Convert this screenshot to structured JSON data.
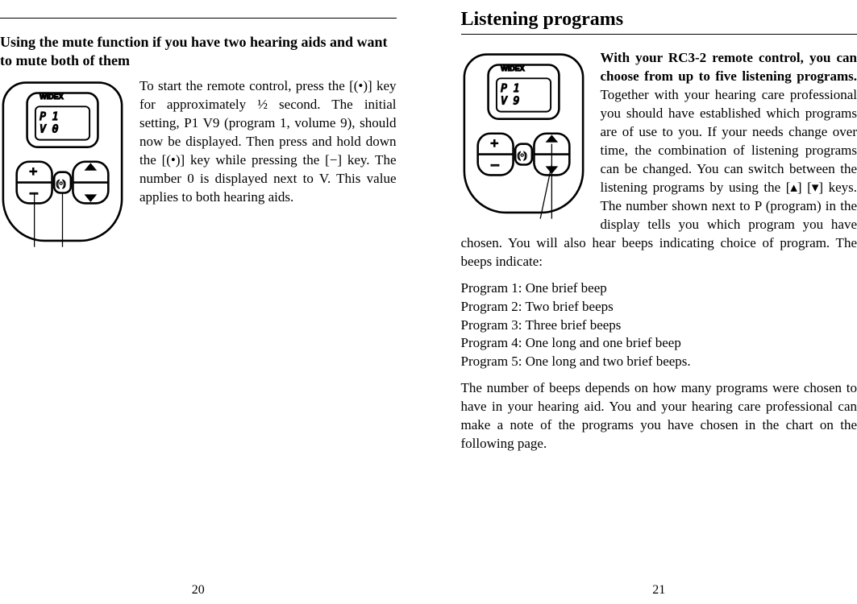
{
  "left": {
    "subhead": "Using the mute function if you have two hearing aids and want to mute both of them",
    "paragraph": "To start the remote control, press the [(•)] key for approximately ½ second. The initial setting, P1 V9 (program 1, volume 9), should now be displayed. Then press and hold down the [(•)] key while pressing the [−] key. The number 0 is  displayed next to V. This value applies to both hearing aids.",
    "device": {
      "brand": "WIDEX",
      "line1": "P  1",
      "line2": "V  0"
    },
    "pagenum": "20"
  },
  "right": {
    "title": "Listening programs",
    "intro_bold": "With your RC3-2 remote control, you can choose from up to five listening programs.",
    "intro_rest": " Together with your hearing care professional you should have established which programs are of use to you. If your needs change over time, the combination of listening programs can be changed. You can switch between the listening programs by using the [▴] [▾] keys. The number shown next to P (program) in the display tells you which program you have chosen. You will also hear beeps indicating choice of program. The beeps indicate:",
    "programs": [
      "Program 1: One brief beep",
      "Program 2: Two brief beeps",
      "Program 3: Three brief beeps",
      "Program 4: One long and one brief beep",
      "Program 5: One long and two brief beeps."
    ],
    "outro": "The number of beeps depends on how many programs were chosen to have in your hearing aid. You and your hearing care professional can make a note of the programs you have chosen in the chart on the following page.",
    "device": {
      "brand": "WIDEX",
      "line1": "P  1",
      "line2": "V  9"
    },
    "pagenum": "21"
  }
}
